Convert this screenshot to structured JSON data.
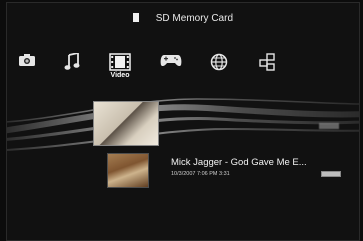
{
  "header": {
    "storage_label": "SD Memory Card",
    "storage_icon": "sd-card-icon"
  },
  "xmb": {
    "categories": [
      {
        "icon": "camera-icon",
        "label": ""
      },
      {
        "icon": "music-note-icon",
        "label": ""
      },
      {
        "icon": "film-strip-icon",
        "label": "Video"
      },
      {
        "icon": "gamepad-icon",
        "label": ""
      },
      {
        "icon": "globe-icon",
        "label": ""
      },
      {
        "icon": "network-icon",
        "label": ""
      }
    ]
  },
  "media_list": {
    "items": [
      {
        "title": "",
        "subtitle": "",
        "selected": true
      },
      {
        "title": "Mick Jagger - God Gave Me E...",
        "subtitle": "10/3/2007   7:06 PM   3:31",
        "selected": false
      }
    ]
  },
  "colors": {
    "background": "#111111",
    "text": "#f2f2f2",
    "wave": "#d9d9d9"
  }
}
